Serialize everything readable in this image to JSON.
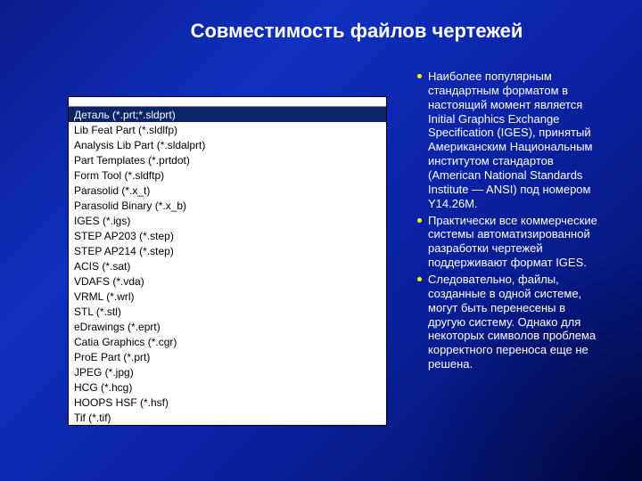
{
  "title": "Совместимость файлов чертежей",
  "dropdown": {
    "items": [
      {
        "label": "Деталь (*.prt;*.sldprt)",
        "selected": true
      },
      {
        "label": "Lib Feat Part (*.sldlfp)",
        "selected": false
      },
      {
        "label": "Analysis Lib Part (*.sldalprt)",
        "selected": false
      },
      {
        "label": "Part Templates (*.prtdot)",
        "selected": false
      },
      {
        "label": "Form Tool (*.sldftp)",
        "selected": false
      },
      {
        "label": "Parasolid (*.x_t)",
        "selected": false
      },
      {
        "label": "Parasolid Binary (*.x_b)",
        "selected": false
      },
      {
        "label": "IGES (*.igs)",
        "selected": false
      },
      {
        "label": "STEP AP203 (*.step)",
        "selected": false
      },
      {
        "label": "STEP AP214 (*.step)",
        "selected": false
      },
      {
        "label": "ACIS (*.sat)",
        "selected": false
      },
      {
        "label": "VDAFS (*.vda)",
        "selected": false
      },
      {
        "label": "VRML (*.wrl)",
        "selected": false
      },
      {
        "label": "STL (*.stl)",
        "selected": false
      },
      {
        "label": "eDrawings (*.eprt)",
        "selected": false
      },
      {
        "label": "Catia Graphics (*.cgr)",
        "selected": false
      },
      {
        "label": "ProE Part (*.prt)",
        "selected": false
      },
      {
        "label": "JPEG (*.jpg)",
        "selected": false
      },
      {
        "label": "HCG (*.hcg)",
        "selected": false
      },
      {
        "label": "HOOPS HSF (*.hsf)",
        "selected": false
      },
      {
        "label": "Tif (*.tif)",
        "selected": false
      }
    ]
  },
  "bullets": [
    "Наиболее популярным стандартным форматом в настоящий момент является Initial Graphics Exchange Specification (IGES), принятый Американским Национальным институтом стандартов (American National Standards Institute — ANSI) под номером Y14.26M.",
    "Практически все коммерческие системы автоматизированной разработки чертежей поддерживают формат IGES.",
    "Следовательно, файлы, созданные в одной системе, могут быть перенесены в другую систему. Однако для некоторых символов проблема корректного переноса еще не решена."
  ]
}
